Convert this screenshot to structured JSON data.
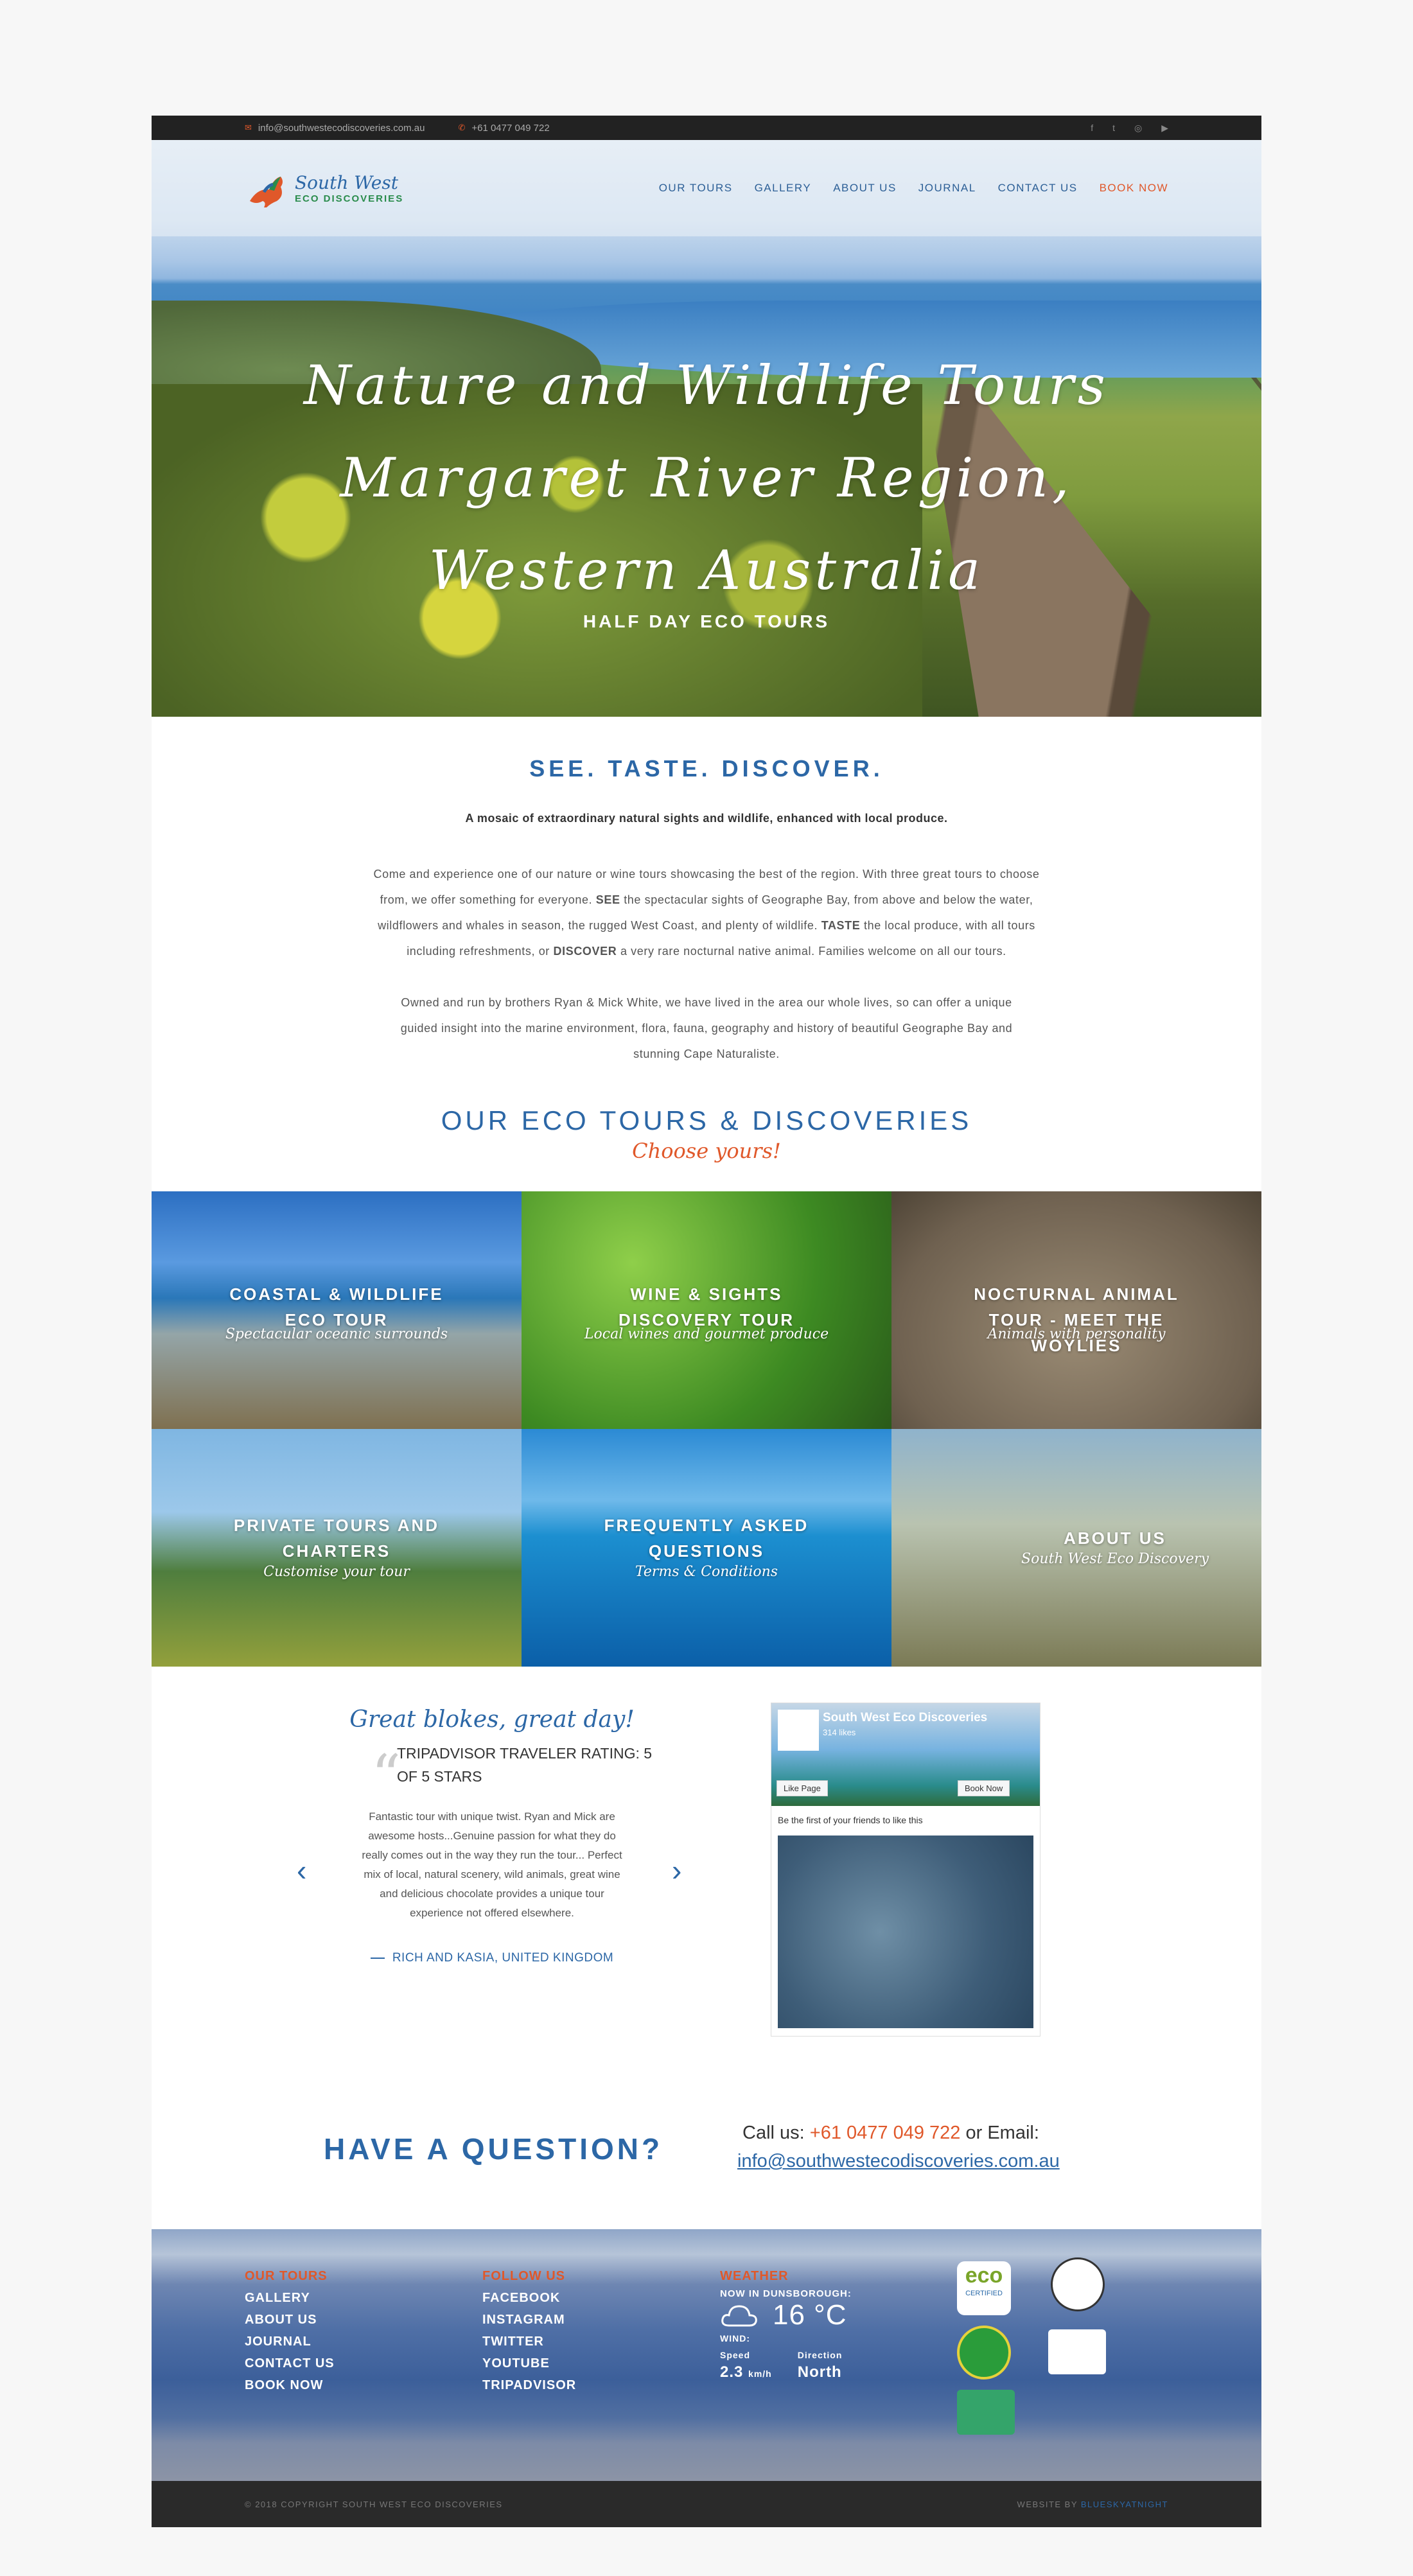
{
  "topbar": {
    "email": "info@southwestecodiscoveries.com.au",
    "phone": "+61 0477 049 722",
    "social": [
      "facebook-icon",
      "twitter-icon",
      "instagram-icon",
      "youtube-icon"
    ]
  },
  "logo": {
    "line1": "South West",
    "line2": "ECO DISCOVERIES"
  },
  "nav": [
    "OUR TOURS",
    "GALLERY",
    "ABOUT US",
    "JOURNAL",
    "CONTACT US",
    "BOOK NOW"
  ],
  "hero": {
    "title_line1": "Nature and Wildlife Tours",
    "title_line2": "Margaret River Region,",
    "title_line3": "Western Australia",
    "subtitle": "HALF DAY ECO TOURS"
  },
  "intro": {
    "heading": "SEE. TASTE. DISCOVER.",
    "lead": "A mosaic of extraordinary natural sights and wildlife, enhanced with local produce.",
    "p1_a": "Come and experience one of our nature or wine tours showcasing the best of the region. With three great tours to choose from, we offer something for everyone. ",
    "p1_b": "SEE",
    "p1_c": " the spectacular sights of Geographe Bay, from above and below the water, wildflowers and whales in season, the rugged West Coast, and plenty of wildlife. ",
    "p1_d": "TASTE",
    "p1_e": " the local produce, with all tours including refreshments, or ",
    "p1_f": "DISCOVER",
    "p1_g": " a very rare nocturnal native animal. Families welcome on all our tours.",
    "p2": "Owned and run by brothers Ryan & Mick White, we have lived in the area our whole lives, so can offer a unique guided insight into the marine environment, flora, fauna, geography and history of beautiful Geographe Bay and stunning Cape Naturaliste.",
    "tours_heading": "OUR ECO TOURS & DISCOVERIES",
    "tours_sub": "Choose yours!"
  },
  "tours": [
    {
      "title": "COASTAL & WILDLIFE ECO TOUR",
      "sub": "Spectacular oceanic surrounds"
    },
    {
      "title": "WINE & SIGHTS DISCOVERY TOUR",
      "sub": "Local wines and gourmet produce"
    },
    {
      "title": "NOCTURNAL ANIMAL TOUR - MEET THE WOYLIES",
      "sub": "Animals with personality"
    },
    {
      "title": "PRIVATE TOURS AND CHARTERS",
      "sub": "Customise your tour"
    },
    {
      "title": "FREQUENTLY ASKED QUESTIONS",
      "sub": "Terms & Conditions"
    },
    {
      "title": "ABOUT US",
      "sub": "South West Eco Discovery"
    }
  ],
  "review": {
    "heading": "Great blokes, great day!",
    "title": "TRIPADVISOR TRAVELER RATING: 5 OF 5 STARS",
    "body": "Fantastic tour with unique twist. Ryan and Mick are awesome hosts...Genuine passion for what they do really comes out in the way they run the tour... Perfect mix of local, natural scenery, wild animals, great wine and delicious chocolate provides a unique tour experience not offered elsewhere.",
    "author": "RICH AND KASIA, UNITED KINGDOM"
  },
  "facebook": {
    "name": "South West Eco Discoveries",
    "likes": "314 likes",
    "like_btn": "Like Page",
    "book_btn": "Book Now",
    "friends": "Be the first of your friends to like this"
  },
  "question": {
    "heading": "HAVE A QUESTION?",
    "call_label": "Call us: ",
    "phone": "+61 0477 049 722",
    "email_label": " or Email:",
    "email": "info@southwestecodiscoveries.com.au"
  },
  "footer": {
    "tours_heading": "OUR TOURS",
    "tours_links": [
      "GALLERY",
      "ABOUT US",
      "JOURNAL",
      "CONTACT US",
      "BOOK NOW"
    ],
    "follow_heading": "FOLLOW US",
    "follow_links": [
      "FACEBOOK",
      "INSTAGRAM",
      "TWITTER",
      "YOUTUBE",
      "TRIPADVISOR"
    ],
    "weather_heading": "WEATHER",
    "weather_now": "NOW IN DUNSBOROUGH:",
    "weather_temp": "16 °C",
    "wind_label": "WIND:",
    "speed_label": "Speed",
    "speed_value": "2.3",
    "speed_unit": "km/h",
    "direction_label": "Direction",
    "direction_value": "North",
    "badges": [
      "eco-certified-badge",
      "finalist-award-badge",
      "accredited-business-badge",
      "heritage-badge",
      "tripadvisor-badge"
    ]
  },
  "copyright": "© 2018 COPYRIGHT SOUTH WEST ECO DISCOVERIES",
  "website_by_label": "WEBSITE BY ",
  "website_by": "BLUESKYATNIGHT",
  "colors": {
    "accent": "#e0582a",
    "brand": "#2c67a6"
  }
}
